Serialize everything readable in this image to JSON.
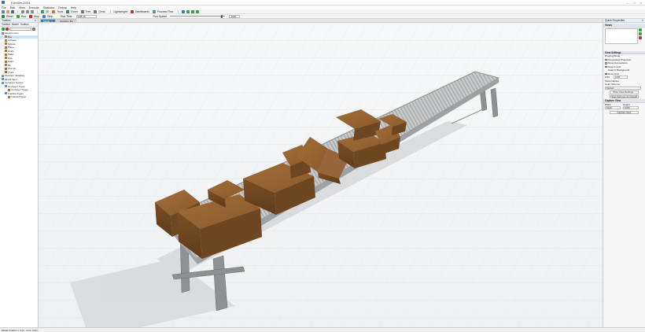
{
  "window": {
    "title": "FlexSim 2024"
  },
  "menu": [
    "File",
    "Edit",
    "View",
    "Execute",
    "Statistics",
    "Debug",
    "Help"
  ],
  "toolbar1": {
    "items": [
      {
        "name": "new-icon",
        "color": "#4a7fc1"
      },
      {
        "name": "open-icon",
        "color": "#e0a030"
      },
      {
        "name": "save-icon",
        "color": "#3a6ab0"
      }
    ],
    "labels": [
      "3D",
      "Tools",
      "Excel",
      "Tree",
      "Grids",
      "Lightweight",
      "Dashboards",
      "Process Flow"
    ]
  },
  "toolbar2": {
    "reset_label": "Reset",
    "run_label": "Run",
    "stop_label": "Stop",
    "step_label": "Step",
    "run_time_label": "Run Time:",
    "run_time_value": "3.88:15",
    "run_speed_label": "Run Speed:",
    "run_speed_value": "1000",
    "run_speed_fraction": 0.95
  },
  "left_panel": {
    "title": "Toolbox",
    "tabs": [
      "Toolbox",
      "Model",
      "Toolbox"
    ],
    "tree": [
      {
        "label": "Flexsim Core",
        "depth": 0,
        "color": "#6a8fb5",
        "selected": false
      },
      {
        "label": "Box",
        "depth": 1,
        "color": "#9a7a4a",
        "selected": true
      },
      {
        "label": "Cylinder",
        "depth": 1,
        "color": "#9a7a4a",
        "selected": false
      },
      {
        "label": "Sphere",
        "depth": 1,
        "color": "#9a7a4a",
        "selected": false
      },
      {
        "label": "Plane",
        "depth": 1,
        "color": "#9a7a4a",
        "selected": false
      },
      {
        "label": "Circle",
        "depth": 1,
        "color": "#9a7a4a",
        "selected": false
      },
      {
        "label": "Pallet",
        "depth": 1,
        "color": "#9a7a4a",
        "selected": false
      },
      {
        "label": "Tote",
        "depth": 1,
        "color": "#9a7a4a",
        "selected": false
      },
      {
        "label": "Case",
        "depth": 1,
        "color": "#9a7a4a",
        "selected": false
      },
      {
        "label": "Bin",
        "depth": 1,
        "color": "#9a7a4a",
        "selected": false
      },
      {
        "label": "Woman",
        "depth": 1,
        "color": "#9a7a4a",
        "selected": false
      },
      {
        "label": "Truck",
        "depth": 1,
        "color": "#9a7a4a",
        "selected": false
      },
      {
        "label": "Flowitem Variables",
        "depth": 0,
        "color": "#6a8fb5",
        "selected": false
      },
      {
        "label": "Model Floor",
        "depth": 0,
        "color": "#6a8fb5",
        "selected": false
      },
      {
        "label": "Conveyor System",
        "depth": 0,
        "color": "#6a8fb5",
        "selected": false
      },
      {
        "label": "Conveyor Types",
        "depth": 1,
        "color": "#6a8fb5",
        "selected": false
      },
      {
        "label": "Conveyor Types",
        "depth": 2,
        "color": "#9a7a4a",
        "selected": false
      },
      {
        "label": "Transfer Types",
        "depth": 1,
        "color": "#6a8fb5",
        "selected": false
      },
      {
        "label": "TransferTypes",
        "depth": 2,
        "color": "#9a7a4a",
        "selected": false
      }
    ]
  },
  "doc_tabs": [
    {
      "label": "Model",
      "active": true
    },
    {
      "label": "Flowitem Bin",
      "active": false
    }
  ],
  "right_panel": {
    "title": "Quick Properties",
    "views_section": "Views",
    "view_settings_section": "View Settings",
    "drawing_mode_label": "Drawing Mode",
    "checkboxes": [
      "Perspective Projection",
      "Show Connections",
      "Snap to Grid",
      "Show Grid"
    ],
    "snap_label": "Snap to Background",
    "fov_label": "FOV",
    "fov_value": "0.00",
    "show_names_label": "Show Names",
    "color_scheme_label": "Color Scheme",
    "color_scheme_value": "Modern",
    "more_btn": "More View Settings...",
    "save_default_btn": "Save Settings as Default",
    "capture_section": "Capture View",
    "width_label": "Width",
    "height_label": "Height",
    "width_value": "1920",
    "height_value": "1080",
    "capture_btn": "Capture View"
  },
  "status": "Model Position: [ 3.41, -2.11, 0.00 ]",
  "colors": {
    "box": "#8a5a2b",
    "roller": "#b9bbbd",
    "frame": "#8e9092",
    "active_tab": "#3b79c7"
  }
}
